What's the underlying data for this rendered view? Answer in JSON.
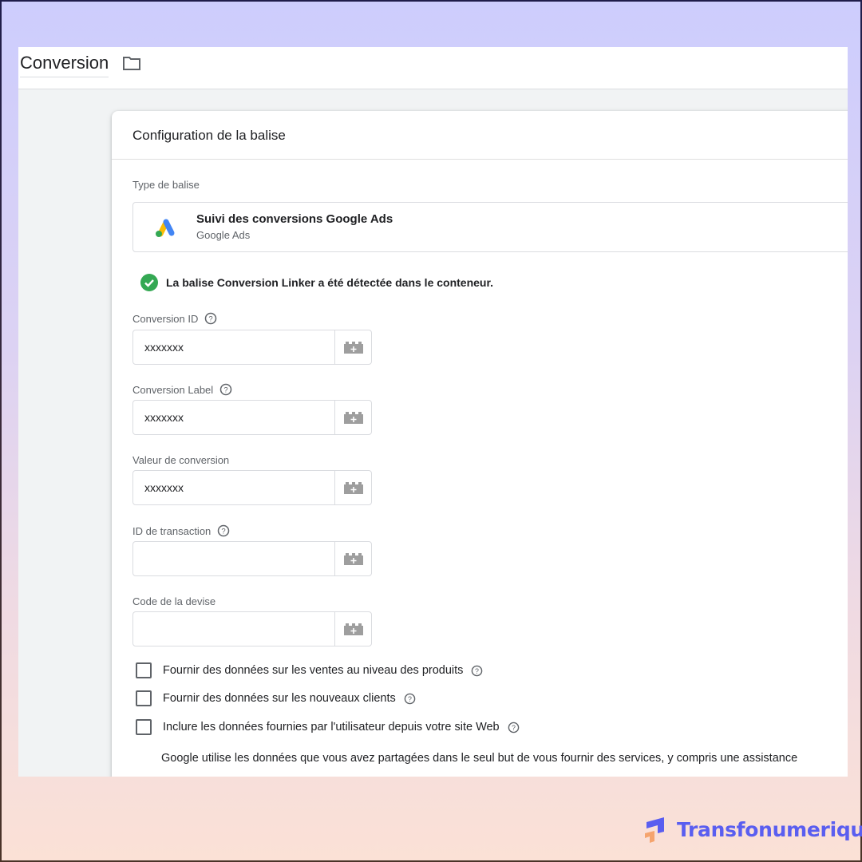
{
  "header": {
    "tag_name": "Conversion",
    "folder_icon": "folder-icon"
  },
  "card": {
    "title": "Configuration de la balise",
    "tag_type_label": "Type de balise",
    "tag_type": {
      "icon": "google-ads-logo",
      "title": "Suivi des conversions Google Ads",
      "subtitle": "Google Ads"
    },
    "notice": {
      "icon": "check-circle-icon",
      "text": "La balise Conversion Linker a été détectée dans le conteneur.",
      "color": "#34a853"
    },
    "fields": [
      {
        "label": "Conversion ID",
        "value": "xxxxxxx",
        "has_help": true
      },
      {
        "label": "Conversion Label",
        "value": "xxxxxxx",
        "has_help": true
      },
      {
        "label": "Valeur de conversion",
        "value": "xxxxxxx",
        "has_help": false
      },
      {
        "label": "ID de transaction",
        "value": "",
        "has_help": true
      },
      {
        "label": "Code de la devise",
        "value": "",
        "has_help": false
      }
    ],
    "checkboxes": [
      {
        "label": "Fournir des données sur les ventes au niveau des produits",
        "checked": false
      },
      {
        "label": "Fournir des données sur les nouveaux clients",
        "checked": false
      },
      {
        "label": "Inclure les données fournies par l'utilisateur depuis votre site Web",
        "checked": false
      }
    ],
    "disclaimer": "Google utilise les données que vous avez partagées dans le seul but de vous fournir des services, y compris une assistance"
  },
  "brand": {
    "name": "Transfonumerique",
    "color": "#5a5ef0"
  }
}
